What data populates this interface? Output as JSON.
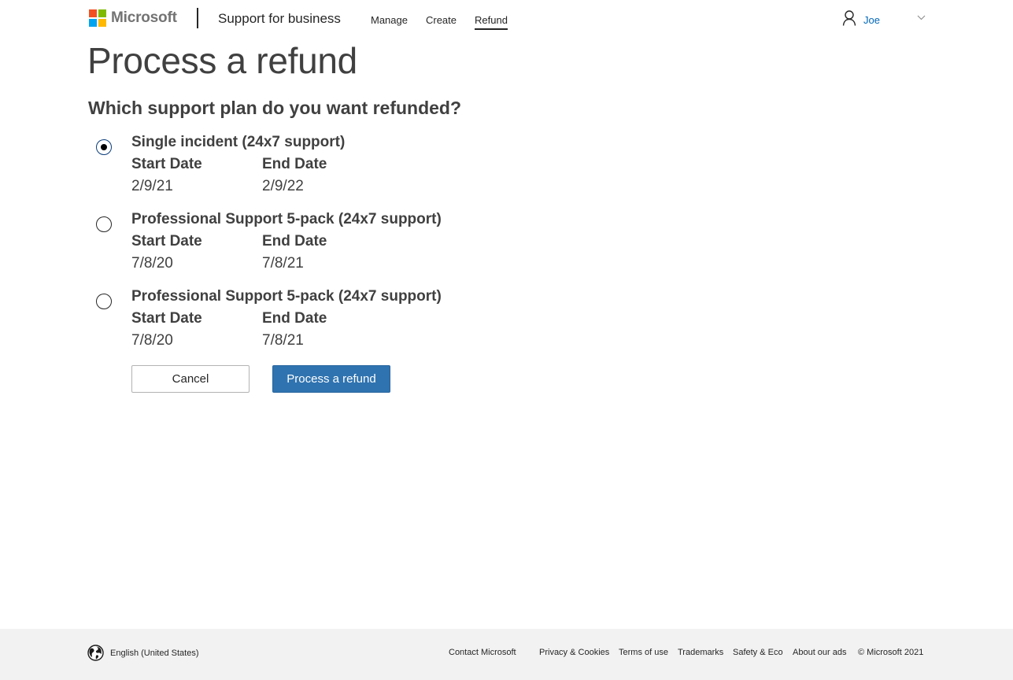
{
  "header": {
    "logo_text": "Microsoft",
    "logo_colors": [
      "#f25022",
      "#7fba00",
      "#00a4ef",
      "#ffb900"
    ],
    "brand_title": "Support for business",
    "nav": [
      {
        "label": "Manage",
        "active": false
      },
      {
        "label": "Create",
        "active": false
      },
      {
        "label": "Refund",
        "active": true
      }
    ],
    "user_name": "Joe",
    "user_icon": "person-icon",
    "menu_icon": "chevron-down-icon"
  },
  "main": {
    "page_title": "Process a refund",
    "question": "Which support plan do you want refunded?",
    "plans": [
      {
        "name": "Single incident (24x7 support)",
        "start_label": "Start Date",
        "end_label": "End Date",
        "start": "2/9/21",
        "end": "2/9/22",
        "selected": true
      },
      {
        "name": "Professional Support 5-pack (24x7 support)",
        "start_label": "Start Date",
        "end_label": "End Date",
        "start": "7/8/20",
        "end": "7/8/21",
        "selected": false
      },
      {
        "name": "Professional Support 5-pack (24x7 support)",
        "start_label": "Start Date",
        "end_label": "End Date",
        "start": "7/8/20",
        "end": "7/8/21",
        "selected": false
      }
    ],
    "cancel_label": "Cancel",
    "submit_label": "Process a refund"
  },
  "footer": {
    "locale": "English (United States)",
    "locale_icon": "globe-icon",
    "links": [
      "Contact Microsoft",
      "Privacy & Cookies",
      "Terms of use",
      "Trademarks",
      "Safety & Eco",
      "About our ads",
      "© Microsoft 2021"
    ]
  },
  "colors": {
    "accent": "#2f73b0",
    "link": "#0067b8",
    "footer_bg": "#f2f2f2"
  }
}
